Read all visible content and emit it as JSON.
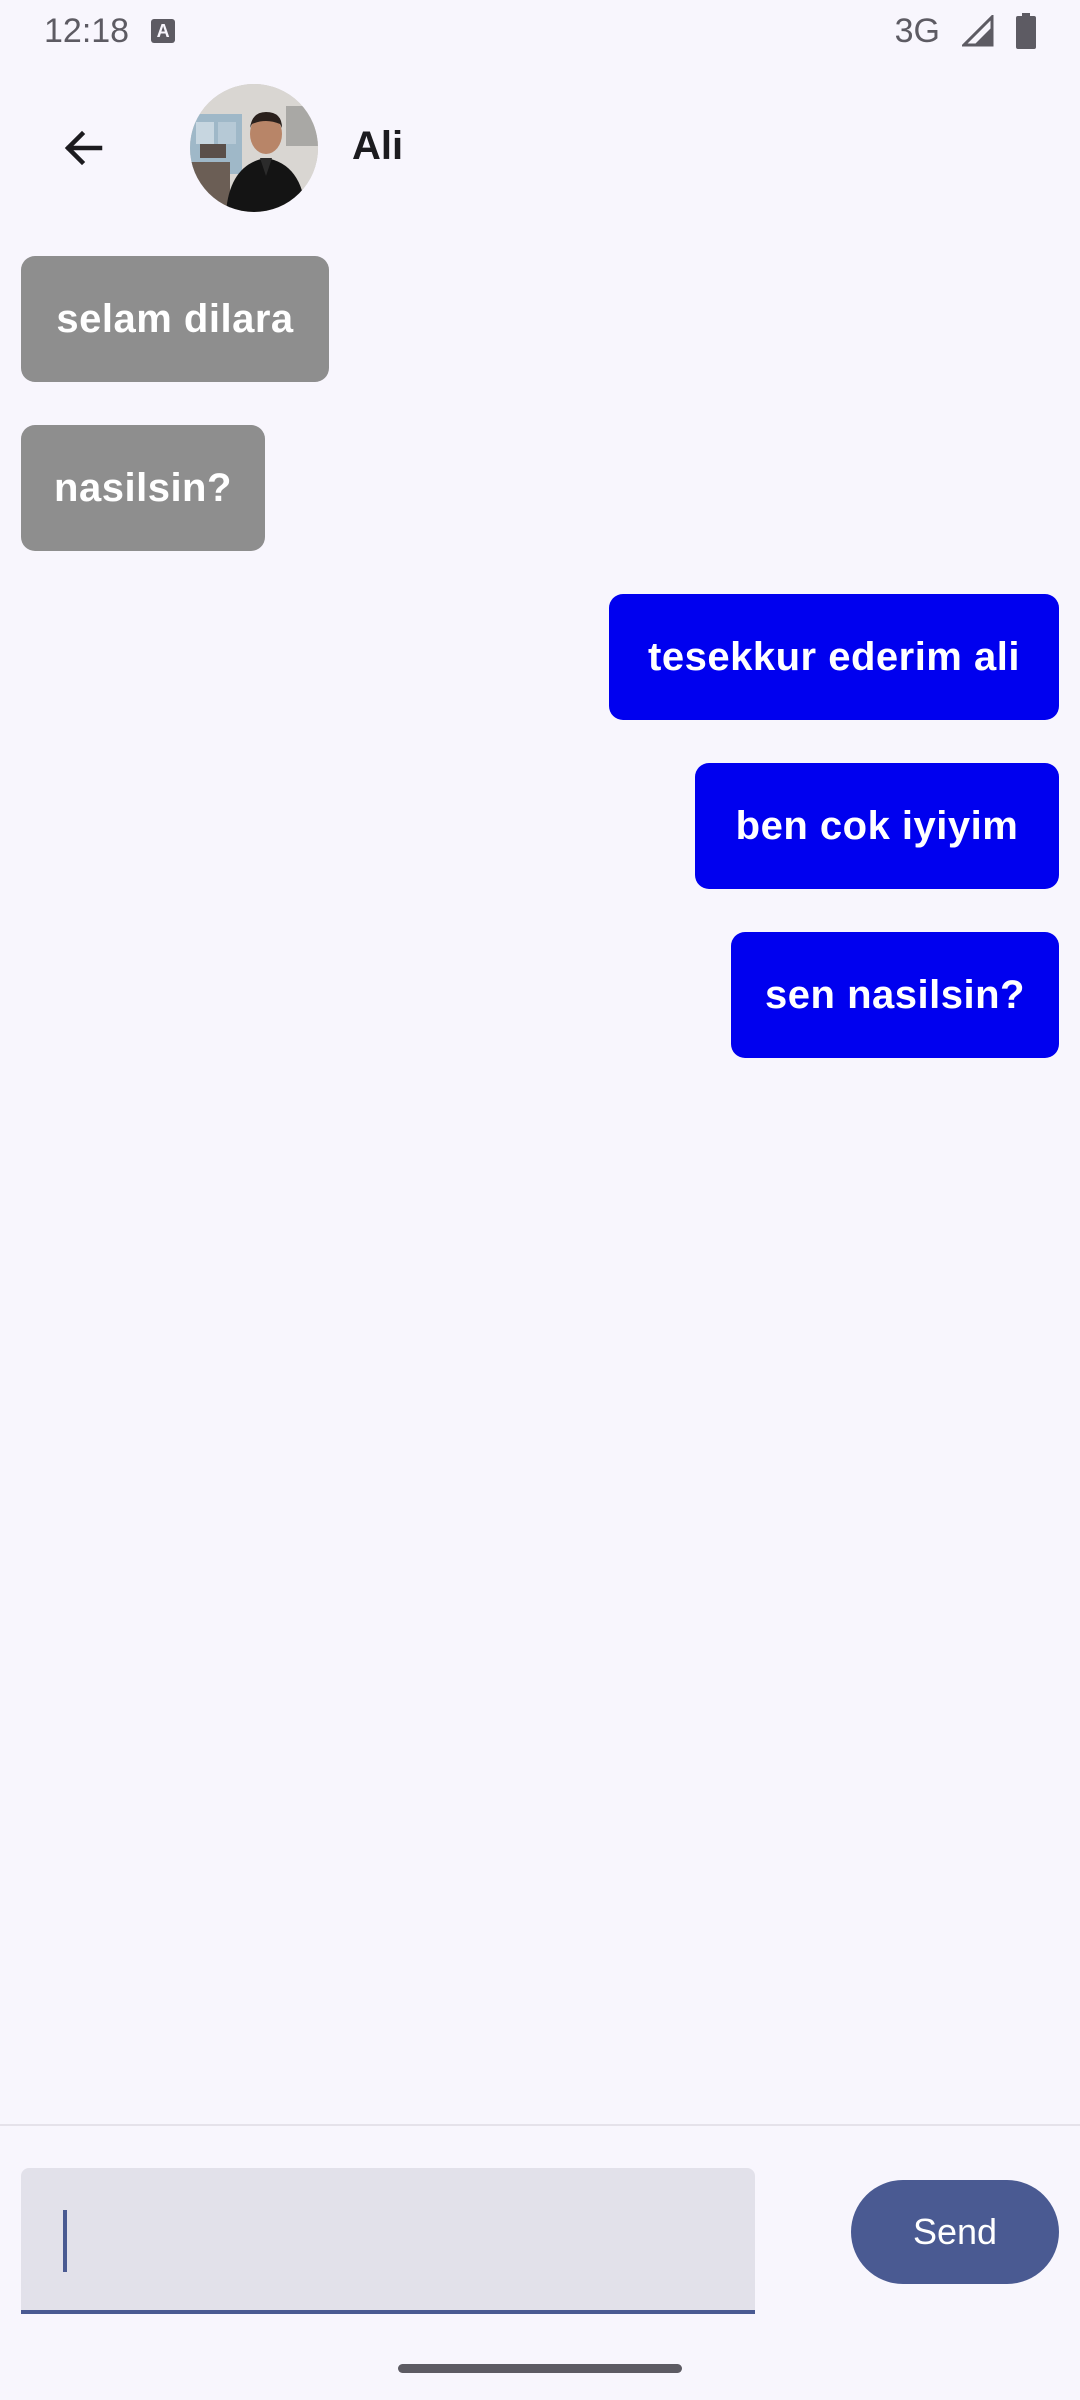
{
  "status_bar": {
    "time": "12:18",
    "app_badge": "A",
    "network": "3G",
    "icons": [
      "signal-icon",
      "battery-icon"
    ]
  },
  "header": {
    "back_icon": "arrow-back-icon",
    "contact_name": "Ali",
    "avatar": "profile-photo"
  },
  "messages": [
    {
      "direction": "incoming",
      "text": "selam dilara"
    },
    {
      "direction": "incoming",
      "text": "nasilsin?"
    },
    {
      "direction": "outgoing",
      "text": "tesekkur ederim ali"
    },
    {
      "direction": "outgoing",
      "text": "ben cok iyiyim"
    },
    {
      "direction": "outgoing",
      "text": "sen nasilsin?"
    }
  ],
  "composer": {
    "input_value": "",
    "send_label": "Send"
  },
  "colors": {
    "incoming_bubble": "#8e8e8e",
    "outgoing_bubble": "#0000ef",
    "accent": "#4a5a92",
    "background": "#f8f6fd"
  }
}
